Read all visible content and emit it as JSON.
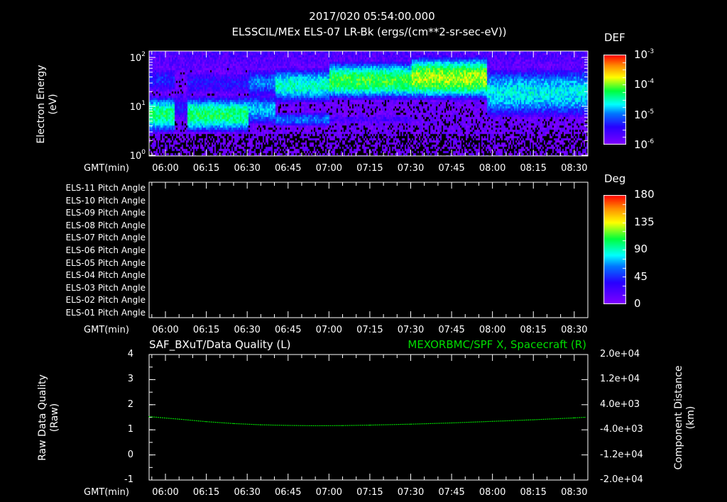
{
  "header": {
    "timestamp": "2017/020 05:54:00.000",
    "product": "ELSSCIL/MEx ELS-07 LR-Bk  (ergs/(cm**2-sr-sec-eV))"
  },
  "time_axis": {
    "label": "GMT(min)",
    "start": "05:54",
    "end": "08:35",
    "ticks": [
      "06:00",
      "06:15",
      "06:30",
      "06:45",
      "07:00",
      "07:15",
      "07:30",
      "07:45",
      "08:00",
      "08:15",
      "08:30"
    ]
  },
  "colors": {
    "line": "#00dd00",
    "title_right": "#00dd00",
    "axis": "#ffffff"
  },
  "chart_data": [
    {
      "type": "heatmap",
      "title": "ELSSCIL/MEx ELS-07 LR-Bk",
      "ylabel": "Electron Energy (eV)",
      "ylabel_lines": [
        "Electron Energy",
        "(eV)"
      ],
      "yscale": "log",
      "ylim": [
        1,
        135
      ],
      "yticks": [
        {
          "base": "10",
          "exp": "0",
          "value": 1
        },
        {
          "base": "10",
          "exp": "1",
          "value": 10
        },
        {
          "base": "10",
          "exp": "2",
          "value": 100
        }
      ],
      "colorbar": {
        "label": "DEF",
        "scale": "log",
        "range": [
          1e-06,
          0.001
        ],
        "ticks": [
          {
            "base": "10",
            "exp": "-3",
            "value": -3
          },
          {
            "base": "10",
            "exp": "-4",
            "value": -4
          },
          {
            "base": "10",
            "exp": "-5",
            "value": -5
          },
          {
            "base": "10",
            "exp": "-6",
            "value": -6
          }
        ]
      },
      "segments": [
        {
          "from": "05:54",
          "to": "06:03",
          "bands": [
            {
              "log_e": 0.85,
              "log_def": -4.3,
              "width": 0.3
            },
            {
              "log_e": 1.55,
              "log_def": -5.3,
              "width": 0.3
            }
          ]
        },
        {
          "from": "06:03",
          "to": "06:08",
          "bands": [
            {
              "log_e": 1.0,
              "log_def": -5.4,
              "width": 0.4
            }
          ]
        },
        {
          "from": "06:08",
          "to": "06:30",
          "bands": [
            {
              "log_e": 0.85,
              "log_def": -4.3,
              "width": 0.3
            },
            {
              "log_e": 1.5,
              "log_def": -5.4,
              "width": 0.3
            }
          ]
        },
        {
          "from": "06:30",
          "to": "06:40",
          "bands": [
            {
              "log_e": 0.95,
              "log_def": -4.8,
              "width": 0.3
            },
            {
              "log_e": 1.5,
              "log_def": -5.0,
              "width": 0.3
            }
          ]
        },
        {
          "from": "06:40",
          "to": "07:00",
          "bands": [
            {
              "log_e": 1.45,
              "log_def": -4.5,
              "width": 0.3
            },
            {
              "log_e": 0.75,
              "log_def": -5.0,
              "width": 0.15
            }
          ]
        },
        {
          "from": "07:00",
          "to": "07:30",
          "bands": [
            {
              "log_e": 1.55,
              "log_def": -4.15,
              "width": 0.3
            },
            {
              "log_e": 0.75,
              "log_def": -5.6,
              "width": 0.15
            }
          ]
        },
        {
          "from": "07:30",
          "to": "07:58",
          "bands": [
            {
              "log_e": 1.6,
              "log_def": -3.9,
              "width": 0.32
            }
          ]
        },
        {
          "from": "07:58",
          "to": "08:35",
          "bands": [
            {
              "log_e": 1.3,
              "log_def": -4.65,
              "width": 0.45
            }
          ]
        }
      ]
    },
    {
      "type": "heatmap",
      "title": "Pitch Angle",
      "rows": [
        "ELS-11 Pitch Angle",
        "ELS-10 Pitch Angle",
        "ELS-09 Pitch Angle",
        "ELS-08 Pitch Angle",
        "ELS-07 Pitch Angle",
        "ELS-06 Pitch Angle",
        "ELS-05 Pitch Angle",
        "ELS-04 Pitch Angle",
        "ELS-03 Pitch Angle",
        "ELS-02 Pitch Angle",
        "ELS-01 Pitch Angle"
      ],
      "values": [],
      "colorbar": {
        "label": "Deg",
        "range": [
          0,
          180
        ],
        "ticks": [
          "180",
          "135",
          "90",
          "45",
          "0"
        ]
      }
    },
    {
      "type": "line",
      "title_left": "SAF_BXuT/Data Quality (L)",
      "title_right": "MEXORBMC/SPF X, Spacecraft (R)",
      "ylabel_left_lines": [
        "Raw Data Quality",
        "(Raw)"
      ],
      "ylabel_right_lines": [
        "Component Distance",
        "(km)"
      ],
      "ylim_left": [
        -1,
        4
      ],
      "yticks_left": [
        "4",
        "3",
        "2",
        "1",
        "0",
        "-1"
      ],
      "ylim_right": [
        -20000,
        20000
      ],
      "yticks_right": [
        "2.0e+04",
        "1.2e+04",
        "4.0e+03",
        "-4.0e+03",
        "-1.2e+04",
        "-2.0e+04"
      ],
      "series": [
        {
          "name": "MEXORBMC/SPF X",
          "axis": "right",
          "x": [
            "05:54",
            "06:05",
            "06:15",
            "06:25",
            "06:35",
            "06:45",
            "06:55",
            "07:05",
            "07:15",
            "07:30",
            "07:45",
            "08:00",
            "08:15",
            "08:30",
            "08:34"
          ],
          "y": [
            200,
            -600,
            -1400,
            -2000,
            -2400,
            -2600,
            -2700,
            -2650,
            -2500,
            -2200,
            -1800,
            -1300,
            -800,
            -200,
            0
          ]
        }
      ]
    }
  ]
}
